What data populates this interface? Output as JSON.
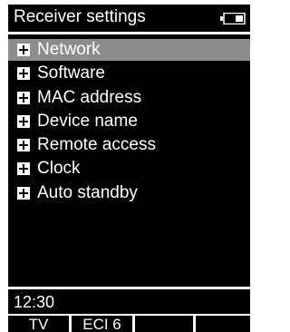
{
  "header": {
    "title": "Receiver settings",
    "battery_icon": "battery-icon"
  },
  "menu": {
    "expand_icon": "plus-box-icon",
    "selected_index": 0,
    "items": [
      {
        "label": "Network"
      },
      {
        "label": "Software"
      },
      {
        "label": "MAC address"
      },
      {
        "label": "Device name"
      },
      {
        "label": "Remote access"
      },
      {
        "label": "Clock"
      },
      {
        "label": "Auto standby"
      }
    ]
  },
  "status": {
    "time": "12:30"
  },
  "softkeys": [
    {
      "label": "TV"
    },
    {
      "label": "ECI 6"
    },
    {
      "label": ""
    },
    {
      "label": ""
    }
  ],
  "colors": {
    "screen_background": "#000000",
    "text": "#ffffff",
    "selection_highlight": "#8c8c8c"
  }
}
